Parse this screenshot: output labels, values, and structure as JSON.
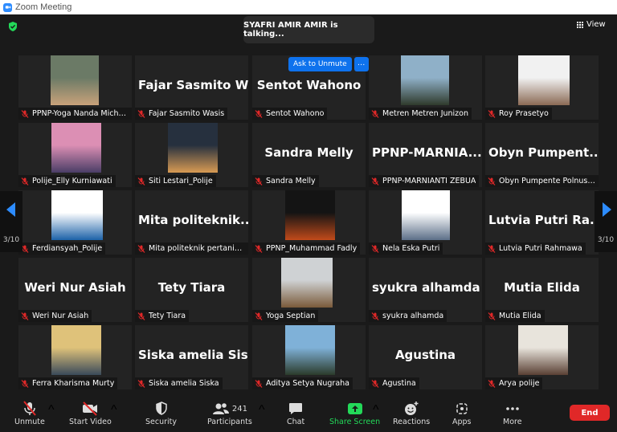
{
  "window": {
    "title": "Zoom Meeting"
  },
  "banner": {
    "talking": "SYAFRI AMIR AMIR is talking..."
  },
  "view": {
    "label": "View"
  },
  "actions": {
    "ask_unmute": "Ask to Unmute",
    "more": "…"
  },
  "pager": {
    "left": "3/10",
    "right": "3/10"
  },
  "tiles": [
    {
      "big": "",
      "name": "PPNP-Yoga Nanda Micho...",
      "video": true
    },
    {
      "big": "Fajar Sasmito W...",
      "name": "Fajar Sasmito Wasis",
      "video": false
    },
    {
      "big": "Sentot Wahono",
      "name": "Sentot Wahono",
      "video": false
    },
    {
      "big": "",
      "name": "Metren Metren Junizon",
      "video": true
    },
    {
      "big": "",
      "name": "Roy Prasetyo",
      "video": true
    },
    {
      "big": "",
      "name": "Polije_Elly Kurniawati",
      "video": true
    },
    {
      "big": "",
      "name": "Siti Lestari_Polije",
      "video": true
    },
    {
      "big": "Sandra Melly",
      "name": "Sandra Melly",
      "video": false
    },
    {
      "big": "PPNP-MARNIA...",
      "name": "PPNP-MARNIANTI ZEBUA",
      "video": false
    },
    {
      "big": "Obyn Pumpent...",
      "name": "Obyn Pumpente Polnustar",
      "video": false
    },
    {
      "big": "",
      "name": "Ferdiansyah_Polije",
      "video": true
    },
    {
      "big": "Mita politeknik...",
      "name": "Mita politeknik pertanian...",
      "video": false
    },
    {
      "big": "",
      "name": "PPNP_Muhammad Fadly",
      "video": true
    },
    {
      "big": "",
      "name": "Nela Eska Putri",
      "video": true
    },
    {
      "big": "Lutvia Putri Ra...",
      "name": "Lutvia Putri Rahmawa",
      "video": false
    },
    {
      "big": "Weri Nur Asiah",
      "name": "Weri Nur Asiah",
      "video": false
    },
    {
      "big": "Tety Tiara",
      "name": "Tety Tiara",
      "video": false
    },
    {
      "big": "",
      "name": "Yoga Septian",
      "video": true
    },
    {
      "big": "syukra alhamda",
      "name": "syukra alhamda",
      "video": false
    },
    {
      "big": "Mutia Elida",
      "name": "Mutia Elida",
      "video": false
    },
    {
      "big": "",
      "name": "Ferra Kharisma Murty",
      "video": true
    },
    {
      "big": "Siska amelia Sis...",
      "name": "Siska amelia Siska",
      "video": false
    },
    {
      "big": "",
      "name": "Aditya Setya Nugraha",
      "video": true
    },
    {
      "big": "Agustina",
      "name": "Agustina",
      "video": false
    },
    {
      "big": "",
      "name": "Arya polije",
      "video": true
    }
  ],
  "toolbar": {
    "unmute": "Unmute",
    "start_video": "Start Video",
    "security": "Security",
    "participants": "Participants",
    "participants_count": "241",
    "chat": "Chat",
    "share_screen": "Share Screen",
    "reactions": "Reactions",
    "apps": "Apps",
    "more": "More",
    "end": "End"
  },
  "colors": {
    "accent": "#0e72ed",
    "share": "#23d959",
    "end": "#e02828",
    "muted_mic": "#e02828"
  }
}
